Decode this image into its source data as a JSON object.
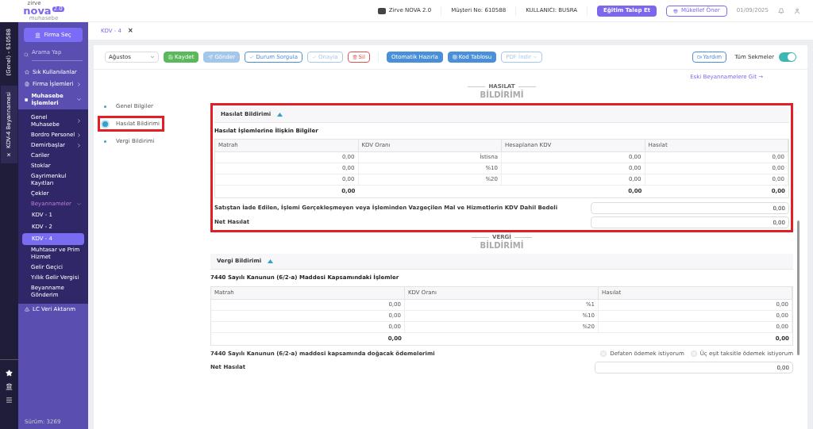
{
  "header": {
    "logo_top": "zirve",
    "logo": "nova",
    "logo_badge": "2.0",
    "logo_sub": "muhasebe",
    "product": "Zirve NOVA 2.0",
    "customer": "Müşteri No: 610588",
    "user": "KULLANICI: BUSRA",
    "training_button": "Eğitim Talep Et",
    "suggest_button": "Mükellef Öner",
    "date": "01/09/2025"
  },
  "rail": {
    "company": "(Genel) - 610588",
    "open_tab": {
      "close": "×",
      "label": "KDV-4 Beyannamesi"
    }
  },
  "sidebar": {
    "firm_button": "Firma Seç",
    "search": {
      "placeholder": "Arama Yap"
    },
    "items": [
      {
        "label": "Sık Kullanılanlar",
        "expanded": false,
        "has_caret": false
      },
      {
        "label": "Firma İşlemleri",
        "expanded": false,
        "has_caret": true
      },
      {
        "label": "Muhasebe İşlemleri",
        "expanded": true,
        "has_caret": true,
        "children": [
          {
            "label": "Genel Muhasebe",
            "has_caret": true,
            "expanded": false,
            "selected": false
          },
          {
            "label": "Bordro Personel",
            "has_caret": true,
            "expanded": false,
            "selected": false
          },
          {
            "label": "Demirbaşlar",
            "has_caret": true,
            "expanded": false,
            "selected": false
          },
          {
            "label": "Cariler",
            "has_caret": false,
            "expanded": false,
            "selected": false
          },
          {
            "label": "Stoklar",
            "has_caret": false,
            "expanded": false,
            "selected": false
          },
          {
            "label": "Gayrimenkul Kayıtları",
            "has_caret": false,
            "expanded": false,
            "selected": false
          },
          {
            "label": "Çekler",
            "has_caret": false,
            "expanded": false,
            "selected": false
          },
          {
            "label": "Beyannameler",
            "has_caret": true,
            "expanded": true,
            "selected": false,
            "children": [
              {
                "label": "KDV - 1",
                "selected": false
              },
              {
                "label": "KDV - 2",
                "selected": false
              },
              {
                "label": "KDV - 4",
                "selected": true
              }
            ]
          },
          {
            "label": "Muhtasar ve Prim Hizmet",
            "has_caret": false,
            "expanded": false,
            "selected": false
          },
          {
            "label": "Gelir Geçici",
            "has_caret": false,
            "expanded": false,
            "selected": false
          },
          {
            "label": "Yıllık Gelir Vergisi",
            "has_caret": false,
            "expanded": false,
            "selected": false
          },
          {
            "label": "Beyanname Gönderim",
            "has_caret": false,
            "expanded": false,
            "selected": false
          }
        ]
      },
      {
        "label": "LC Veri Aktarım",
        "expanded": false,
        "has_caret": false
      }
    ],
    "version": "Sürüm: 3269"
  },
  "breadcrumb": {
    "tab": "KDV - 4",
    "close": "×"
  },
  "toolbar": {
    "month": "Ağustos",
    "buttons": [
      {
        "label": "Kaydet",
        "kind": "green",
        "disabled": false
      },
      {
        "label": "Gönder",
        "kind": "blue",
        "disabled": true
      },
      {
        "label": "Durum Sorgula",
        "kind": "outline",
        "disabled": false
      },
      {
        "label": "Onayla",
        "kind": "outline",
        "disabled": true
      },
      {
        "label": "Sil",
        "kind": "danger",
        "disabled": false
      },
      {
        "label": "Otomatik Hazırla",
        "kind": "blue",
        "disabled": false
      },
      {
        "label": "Kod Tablosu",
        "kind": "blue",
        "disabled": false
      },
      {
        "label": "PDF İndir",
        "kind": "dropdown",
        "disabled": true
      }
    ],
    "help": "Yardım",
    "all_tabs": {
      "label": "Tüm Sekmeler",
      "on": true
    }
  },
  "old_link": "Eski Beyannamelere Git →",
  "steps": [
    {
      "label": "Genel Bilgiler",
      "selected": false,
      "highlighted": false
    },
    {
      "label": "Hasılat Bildirimi",
      "selected": true,
      "highlighted": true
    },
    {
      "label": "Vergi Bildirimi",
      "selected": false,
      "highlighted": false
    }
  ],
  "sections": [
    {
      "heading_top": "HASILAT",
      "heading_bottom": "BİLDİRİMİ",
      "panel_title": "Hasılat Bildirimi",
      "expanded": true,
      "highlighted": true,
      "subtitle": "Hasılat İşlemlerine İlişkin Bilgiler",
      "columns": [
        "Matrah",
        "KDV Oranı",
        "Hesaplanan KDV",
        "Hasılat"
      ],
      "rows": [
        [
          "0,00",
          "İstisna",
          "0,00",
          "0,00"
        ],
        [
          "0,00",
          "%10",
          "0,00",
          "0,00"
        ],
        [
          "0,00",
          "%20",
          "0,00",
          "0,00"
        ]
      ],
      "totals": [
        {
          "kind": "value",
          "value": "0,00"
        },
        {
          "kind": "blank"
        },
        {
          "kind": "value",
          "value": "0,00"
        },
        {
          "kind": "value",
          "value": "0,00"
        }
      ],
      "fields": [
        {
          "label": "Satıştan İade Edilen, İşlemi Gerçekleşmeyen veya İşleminden Vazgeçilen Mal ve Hizmetlerin KDV Dahil Bedeli",
          "value": "0,00"
        },
        {
          "label": "Net Hasılat",
          "value": "0,00"
        }
      ]
    },
    {
      "heading_top": "VERGİ",
      "heading_bottom": "BİLDİRİMİ",
      "panel_title": "Vergi Bildirimi",
      "expanded": true,
      "highlighted": false,
      "subtitle": "7440 Sayılı Kanunun (6/2-a) Maddesi Kapsamındaki İşlemler",
      "columns": [
        "Matrah",
        "KDV Oranı",
        "Hasılat"
      ],
      "rows": [
        [
          "0,00",
          "%1",
          "0,00"
        ],
        [
          "0,00",
          "%10",
          "0,00"
        ],
        [
          "0,00",
          "%20",
          "0,00"
        ]
      ],
      "totals": [
        {
          "kind": "value",
          "value": "0,00"
        },
        {
          "kind": "blank"
        },
        {
          "kind": "value",
          "value": "0,00"
        }
      ],
      "payment": {
        "label": "7440 Sayılı Kanunun (6/2-a) maddesi kapsamında doğacak ödemelerimi",
        "options": [
          {
            "label": "Defaten ödemek istiyorum",
            "selected": false
          },
          {
            "label": "Üç eşit taksitle ödemek istiyorum",
            "selected": false
          }
        ]
      },
      "fields": [
        {
          "label": "Net Hasılat",
          "value": "0,00"
        }
      ]
    }
  ]
}
